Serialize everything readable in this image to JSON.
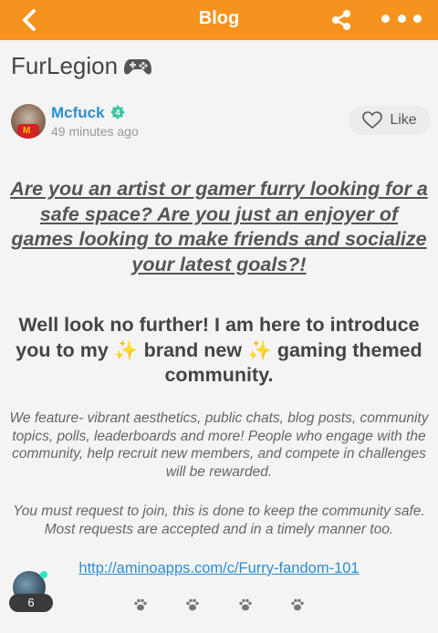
{
  "header": {
    "title": "Blog",
    "back_icon": "chevron-left-icon",
    "share_icon": "share-icon",
    "more_icon": "more-horizontal-icon",
    "background": "#f5931e"
  },
  "post": {
    "title": "FurLegion",
    "title_emoji": "gamepad-icon",
    "author": {
      "name": "Mcfuck",
      "level": "4",
      "timestamp": "49 minutes ago"
    },
    "like_label": "Like",
    "intro": "Are you an artist or gamer furry looking for a safe space? Are you just an enjoyer of games looking to make friends and socialize your latest goals?!",
    "headline_part1": "Well look no further! I am here to introduce you to my ",
    "headline_sparkle": "✨",
    "headline_part2": " brand new ",
    "headline_part3": " gaming themed community.",
    "features": "We feature- vibrant aesthetics, public chats, blog posts, community topics, polls, leaderboards and more! People who engage with the community, help recruit new members, and compete in challenges will be rewarded.",
    "request": "You must request to join, this is done to keep the community safe. Most requests are accepted and in a timely manner too.",
    "link": "http://aminoapps.com/c/Furry-fandom-101"
  },
  "floating": {
    "count": "6"
  },
  "colors": {
    "accent": "#f5931e",
    "link": "#2a8fcf",
    "badge": "#3cc6a0",
    "online": "#2ee8c5"
  }
}
